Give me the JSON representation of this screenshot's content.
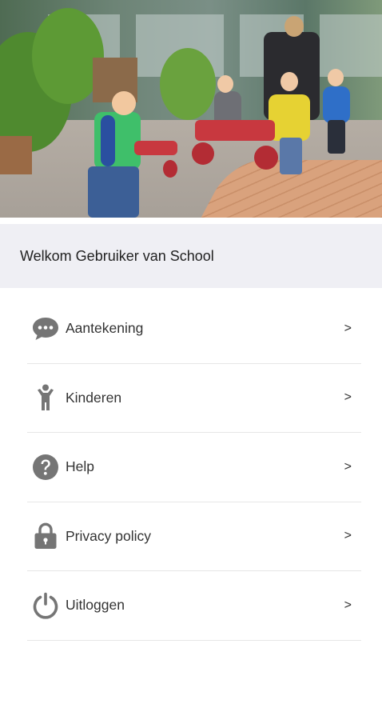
{
  "welcome": {
    "text": "Welkom Gebruiker van School"
  },
  "menu": {
    "items": [
      {
        "label": "Aantekening",
        "icon": "chat-bubble-icon",
        "chevron": ">"
      },
      {
        "label": "Kinderen",
        "icon": "child-icon",
        "chevron": ">"
      },
      {
        "label": "Help",
        "icon": "help-icon",
        "chevron": ">"
      },
      {
        "label": "Privacy policy",
        "icon": "lock-icon",
        "chevron": ">"
      },
      {
        "label": "Uitloggen",
        "icon": "power-icon",
        "chevron": ">"
      }
    ]
  },
  "colors": {
    "icon": "#757575",
    "band": "#efeff4",
    "divider": "#e6e6e6"
  }
}
